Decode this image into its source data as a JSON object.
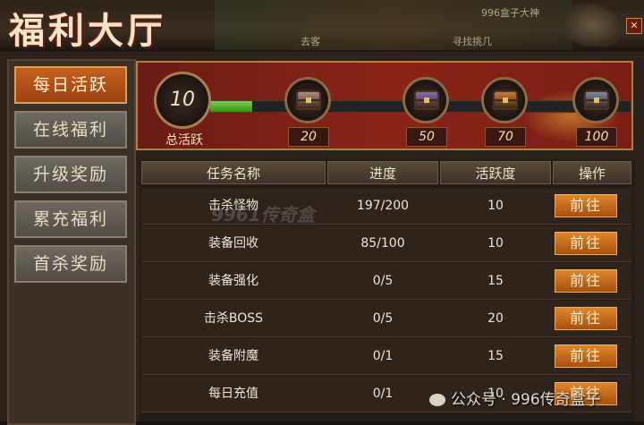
{
  "header": {
    "title": "福利大厅",
    "bg_texts": [
      "996盒子大神",
      "去客",
      "寻找挑几"
    ],
    "close_label": "✕"
  },
  "sidebar": {
    "items": [
      {
        "label": "每日活跃",
        "active": true
      },
      {
        "label": "在线福利",
        "active": false
      },
      {
        "label": "升级奖励",
        "active": false
      },
      {
        "label": "累充福利",
        "active": false
      },
      {
        "label": "首杀奖励",
        "active": false
      }
    ]
  },
  "activity": {
    "total_value": "10",
    "total_label": "总活跃",
    "progress_fraction": 0.1,
    "milestones": [
      {
        "value": "20",
        "chest_color": "#b48a8a"
      },
      {
        "value": "50",
        "chest_color": "#8a6ab4"
      },
      {
        "value": "70",
        "chest_color": "#d0783a"
      },
      {
        "value": "100",
        "chest_color": "#7a8aa4"
      }
    ]
  },
  "table": {
    "headers": [
      "任务名称",
      "进度",
      "活跃度",
      "操作"
    ],
    "rows": [
      {
        "name": "击杀怪物",
        "progress": "197/200",
        "activity": "10",
        "action": "前往"
      },
      {
        "name": "装备回收",
        "progress": "85/100",
        "activity": "10",
        "action": "前往"
      },
      {
        "name": "装备强化",
        "progress": "0/5",
        "activity": "15",
        "action": "前往"
      },
      {
        "name": "击杀BOSS",
        "progress": "0/5",
        "activity": "20",
        "action": "前往"
      },
      {
        "name": "装备附魔",
        "progress": "0/1",
        "activity": "15",
        "action": "前往"
      },
      {
        "name": "每日充值",
        "progress": "0/1",
        "activity": "10",
        "action": "前往"
      }
    ]
  },
  "watermark": "9961传奇盒",
  "footer": {
    "wechat_text": "公众号 · 996传奇盒子"
  }
}
